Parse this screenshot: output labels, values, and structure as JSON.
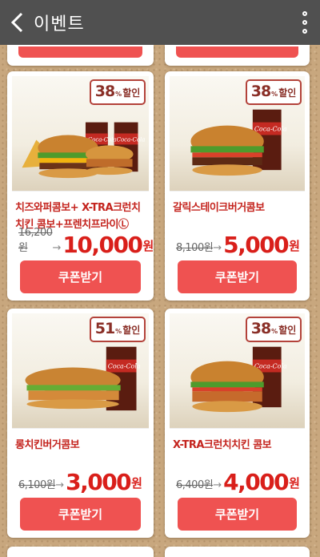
{
  "header": {
    "title": "이벤트"
  },
  "coupons": [
    {
      "badge_pct": "38",
      "badge_small": "%",
      "badge_label": "할인",
      "name": "치즈와퍼콤보+ X-TRA크런치치킨 콤보+프렌치프라이Ⓛ",
      "old_price": "16,200원",
      "new_price": "10,000",
      "won": "원",
      "button": "쿠폰받기"
    },
    {
      "badge_pct": "38",
      "badge_small": "%",
      "badge_label": "할인",
      "name": "갈릭스테이크버거콤보",
      "old_price": "8,100원",
      "new_price": "5,000",
      "won": "원",
      "button": "쿠폰받기"
    },
    {
      "badge_pct": "51",
      "badge_small": "%",
      "badge_label": "할인",
      "name": "롱치킨버거콤보",
      "old_price": "6,100원",
      "new_price": "3,000",
      "won": "원",
      "button": "쿠폰받기"
    },
    {
      "badge_pct": "38",
      "badge_small": "%",
      "badge_label": "할인",
      "name": "X-TRA크런치치킨 콤보",
      "old_price": "6,400원",
      "new_price": "4,000",
      "won": "원",
      "button": "쿠폰받기"
    }
  ],
  "drink_brand": "Coca-Cola",
  "colors": {
    "accent": "#ef5251",
    "price": "#d91f1a",
    "appbar": "#505050"
  },
  "icons": {
    "back": "chevron-left-icon",
    "menu": "more-vertical-icon"
  }
}
